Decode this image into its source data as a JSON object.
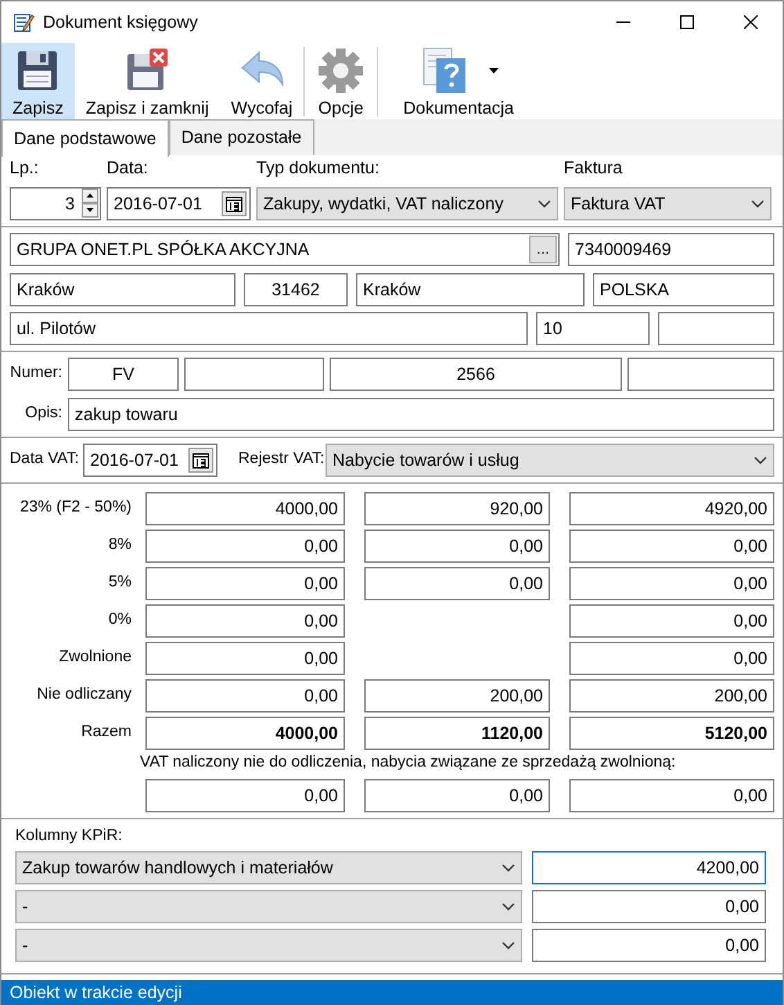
{
  "window": {
    "title": "Dokument księgowy"
  },
  "toolbar": [
    {
      "label": "Zapisz",
      "kind": "save",
      "selected": true,
      "separator_before": false
    },
    {
      "label": "Zapisz i zamknij",
      "kind": "save-close",
      "selected": false,
      "separator_before": false
    },
    {
      "label": "Wycofaj",
      "kind": "undo",
      "selected": false,
      "separator_before": false
    },
    {
      "label": "Opcje",
      "kind": "options",
      "selected": false,
      "separator_before": true
    },
    {
      "label": "Dokumentacja",
      "kind": "help",
      "selected": false,
      "separator_before": true,
      "dropdown": true
    }
  ],
  "tabs": [
    {
      "label": "Dane podstawowe",
      "selected": true
    },
    {
      "label": "Dane pozostałe",
      "selected": false
    }
  ],
  "header": {
    "lp": {
      "label": "Lp.:",
      "value": "3"
    },
    "date": {
      "label": "Data:",
      "value": "2016-07-01"
    },
    "type": {
      "label": "Typ dokumentu:",
      "value": "Zakupy, wydatki, VAT naliczony"
    },
    "invoice": {
      "label": "Faktura",
      "value": "Faktura VAT"
    }
  },
  "contractor": {
    "name": "GRUPA ONET.PL SPÓŁKA AKCYJNA",
    "browse": "...",
    "nip": "7340009469",
    "city": "Kraków",
    "postal_code": "31462",
    "post_office": "Kraków",
    "country": "POLSKA",
    "street": "ul. Pilotów",
    "building": "10"
  },
  "number": {
    "label": "Numer:",
    "prefix": "FV",
    "value": "2566"
  },
  "description": {
    "label": "Opis:",
    "value": "zakup towaru"
  },
  "vat_date": {
    "label": "Data VAT:",
    "value": "2016-07-01"
  },
  "vat_register": {
    "label": "Rejestr VAT:",
    "value": "Nabycie towarów i usług"
  },
  "vat_rows": [
    {
      "label": "23% (F2 - 50%)",
      "kind": "rate",
      "net": "4000,00",
      "vat": "920,00",
      "gross": "4920,00"
    },
    {
      "label": "8%",
      "kind": "rate",
      "net": "0,00",
      "vat": "0,00",
      "gross": "0,00"
    },
    {
      "label": "5%",
      "kind": "rate",
      "net": "0,00",
      "vat": "0,00",
      "gross": "0,00"
    },
    {
      "label": "0%",
      "kind": "rate",
      "net": "0,00",
      "gross": "0,00"
    },
    {
      "label": "Zwolnione",
      "kind": "rate",
      "net": "0,00",
      "gross": "0,00"
    },
    {
      "label": "Nie odliczany",
      "kind": "rate",
      "net": "0,00",
      "vat": "200,00",
      "gross": "200,00"
    },
    {
      "label": "Razem",
      "kind": "total",
      "net": "4000,00",
      "vat": "1120,00",
      "gross": "5120,00"
    }
  ],
  "nondeductible": {
    "label": "VAT naliczony nie do odliczenia, nabycia związane ze sprzedażą zwolnioną:",
    "net": "0,00",
    "vat": "0,00",
    "gross": "0,00"
  },
  "kpir": {
    "label": "Kolumny KPiR:",
    "rows": [
      {
        "column": "Zakup towarów handlowych i materiałów",
        "amount": "4200,00",
        "focused": true
      },
      {
        "column": "-",
        "amount": "0,00",
        "focused": false
      },
      {
        "column": "-",
        "amount": "0,00",
        "focused": false
      }
    ]
  },
  "status_bar": "Obiekt w trakcie edycji"
}
